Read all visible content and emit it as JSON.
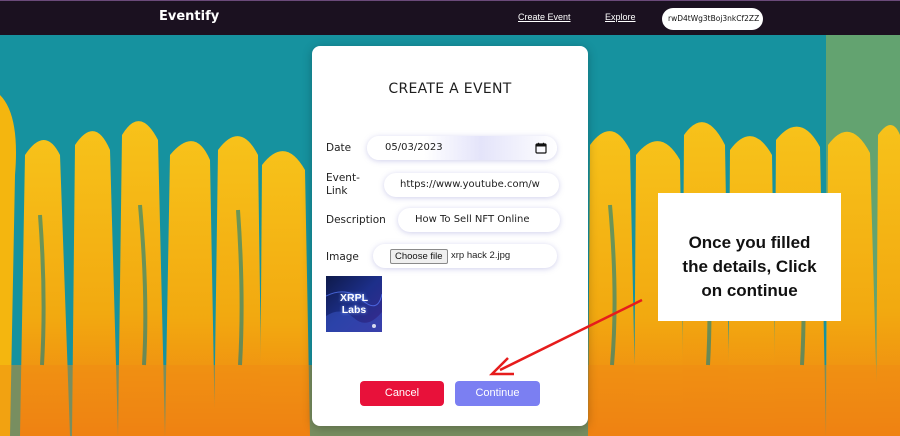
{
  "navbar": {
    "brand": "Eventify",
    "links": [
      "Create Event",
      "Explore"
    ],
    "wallet_address": "rwD4tWg3tBoj3nkCf2ZZ"
  },
  "form": {
    "title": "CREATE A EVENT",
    "date": {
      "label": "Date",
      "value": "05/03/2023"
    },
    "event_link": {
      "label_line1": "Event-",
      "label_line2": "Link",
      "value": "https://www.youtube.com/w"
    },
    "description": {
      "label": "Description",
      "value": "How To Sell NFT Online"
    },
    "image": {
      "label": "Image",
      "file_button": "Choose file",
      "file_name": "xrp hack 2.jpg",
      "preview_text": "XRPL Labs"
    },
    "cancel_label": "Cancel",
    "continue_label": "Continue"
  },
  "callout": {
    "text_line1": "Once you filled",
    "text_line2": "the details, Click",
    "text_line3": "on continue"
  },
  "colors": {
    "navbar": "#1b1120",
    "cancel": "#e8113a",
    "continue": "#7b7ff2",
    "arrow": "#e61c1c"
  }
}
